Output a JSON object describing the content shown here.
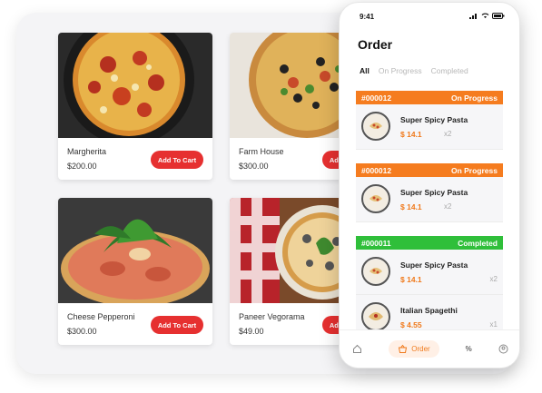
{
  "products": [
    {
      "name": "Margherita",
      "price": "$200.00",
      "button": "Add To Cart"
    },
    {
      "name": "Farm House",
      "price": "$300.00",
      "button": "Add To Cart"
    },
    {
      "name": "Cheese Pepperoni",
      "price": "$300.00",
      "button": "Add To Cart"
    },
    {
      "name": "Paneer Vegorama",
      "price": "$49.00",
      "button": "Add To Cart"
    }
  ],
  "phone": {
    "time": "9:41",
    "title": "Order",
    "tabs": [
      "All",
      "On Progress",
      "Completed"
    ],
    "orders": [
      {
        "id": "#000012",
        "status": "On Progress",
        "color": "#f57c1f",
        "items": [
          {
            "name": "Super Spicy Pasta",
            "price": "$ 14.1",
            "qty": "x2"
          }
        ]
      },
      {
        "id": "#000012",
        "status": "On Progress",
        "color": "#f57c1f",
        "items": [
          {
            "name": "Super Spicy Pasta",
            "price": "$ 14.1",
            "qty": "x2"
          }
        ]
      },
      {
        "id": "#000011",
        "status": "Completed",
        "color": "#2fbf3a",
        "items": [
          {
            "name": "Super Spicy Pasta",
            "price": "$ 14.1",
            "qty": "x2"
          },
          {
            "name": "Italian Spagethi",
            "price": "$ 4.55",
            "qty": "x1"
          }
        ]
      }
    ],
    "nav": {
      "active_label": "Order",
      "percent_label": "%"
    }
  },
  "colors": {
    "accent": "#f07a1c",
    "cart_button": "#e63030",
    "progress": "#f57c1f",
    "completed": "#2fbf3a"
  }
}
